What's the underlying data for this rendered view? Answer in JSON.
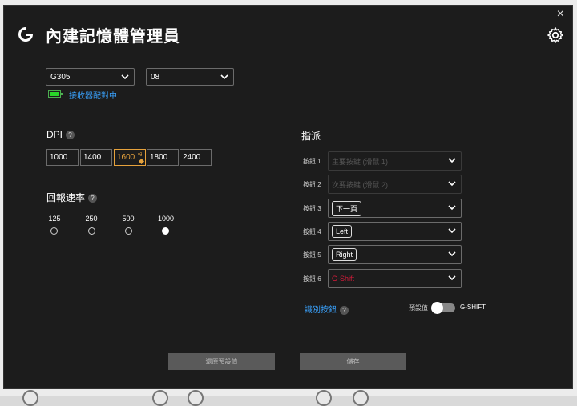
{
  "window": {
    "title": "內建記憶體管理員"
  },
  "device": {
    "model": "G305",
    "profile": "08",
    "pairing_status": "接收器配對中"
  },
  "dpi": {
    "title": "DPI",
    "levels": [
      "1000",
      "1400",
      "1600",
      "1800",
      "2400"
    ],
    "active_index": 2
  },
  "report_rate": {
    "title": "回報速率",
    "options": [
      "125",
      "250",
      "500",
      "1000"
    ],
    "selected": "1000"
  },
  "assign": {
    "title": "指派",
    "buttons": [
      {
        "label": "按鈕 1",
        "value": "主要按鍵 (滑鼠 1)",
        "state": "disabled"
      },
      {
        "label": "按鈕 2",
        "value": "次要按鍵 (滑鼠 2)",
        "state": "disabled"
      },
      {
        "label": "按鈕 3",
        "value": "下一頁",
        "state": "chip"
      },
      {
        "label": "按鈕 4",
        "value": "Left",
        "state": "chip"
      },
      {
        "label": "按鈕 5",
        "value": "Right",
        "state": "chip"
      },
      {
        "label": "按鈕 6",
        "value": "G-Shift",
        "state": "gshift"
      }
    ],
    "detect_label": "識別按鈕",
    "default_label": "預設值",
    "gshift_label": "G-SHIFT"
  },
  "footer": {
    "restore_label": "還原預設值",
    "save_label": "儲存"
  },
  "help_glyph": "?",
  "close_glyph": "×",
  "colors": {
    "accent_blue": "#3aa3ff",
    "active_orange": "#e6a23c",
    "gshift_red": "#d81b3b",
    "battery_green": "#29d629"
  }
}
